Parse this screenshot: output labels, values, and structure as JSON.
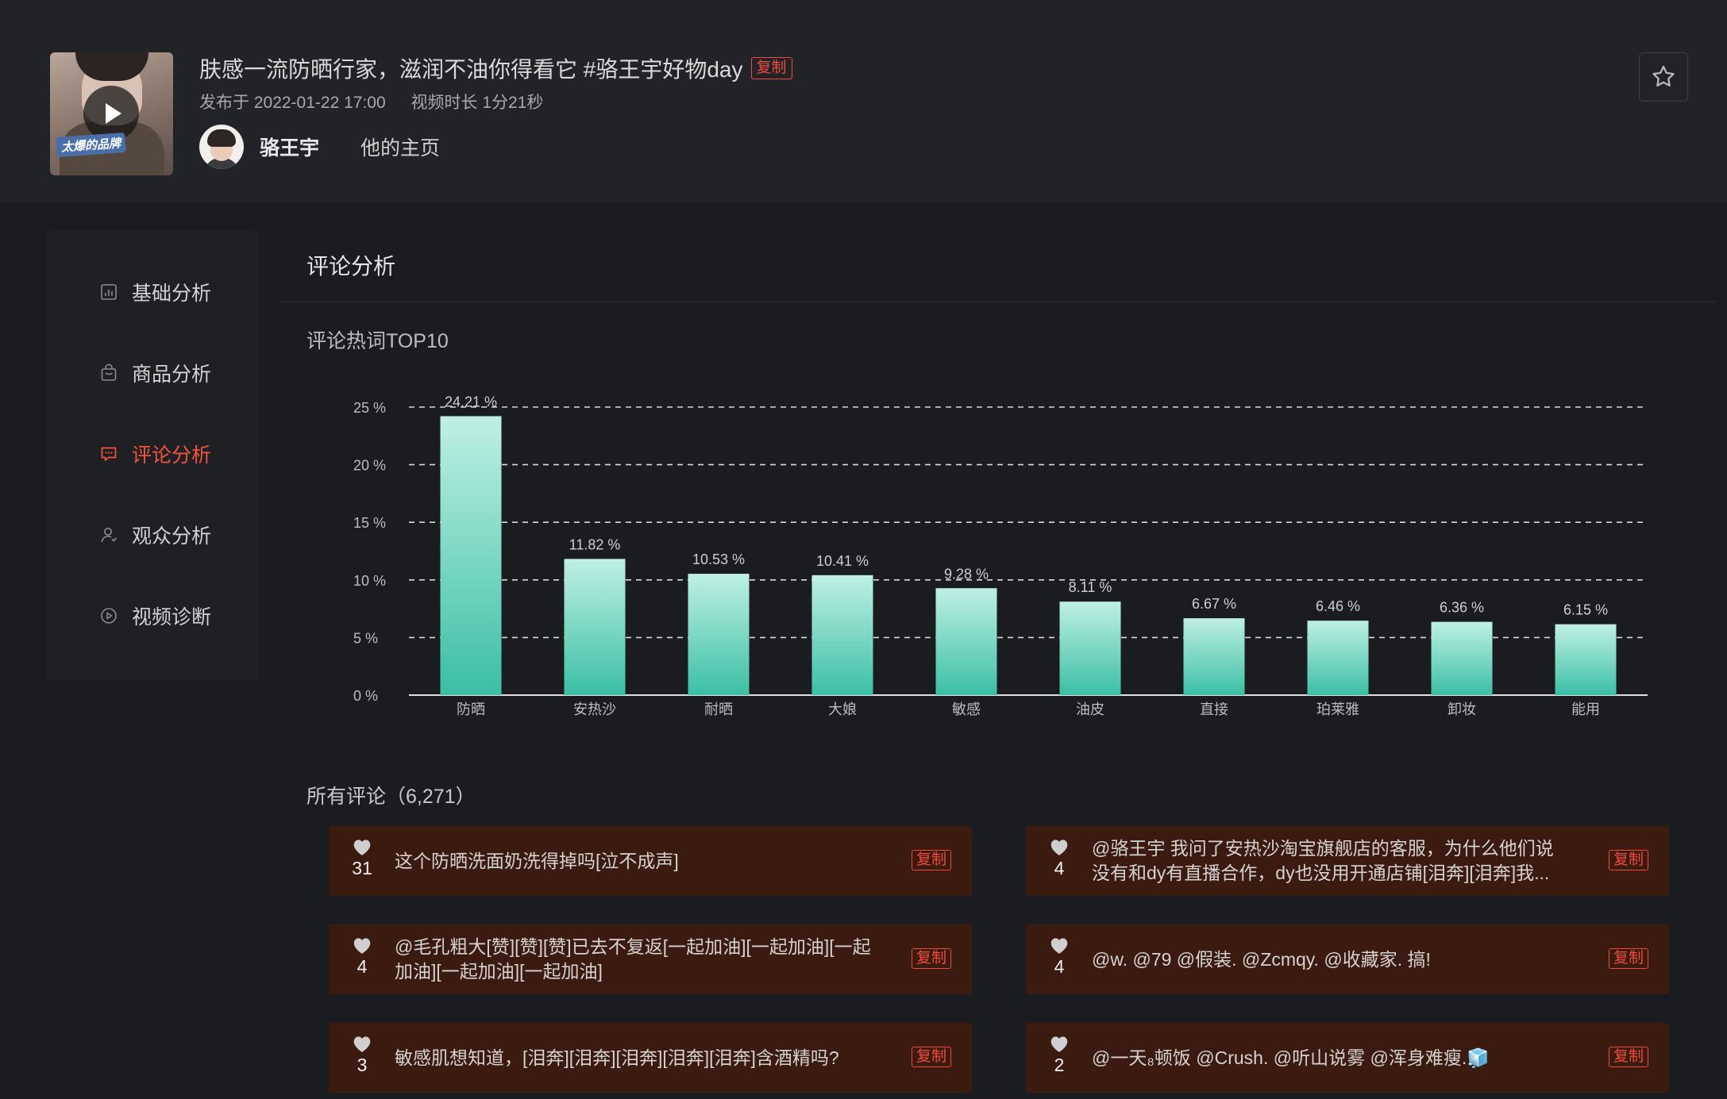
{
  "header": {
    "title": "肤感一流防晒行家，滋润不油你得看它 #骆王宇好物day",
    "copy_label": "复制",
    "publish_time": "发布于 2022-01-22 17:00",
    "duration": "视频时长 1分21秒",
    "author_name": "骆王宇",
    "homepage_label": "他的主页",
    "thumbnail_sticker": "太爆的品牌"
  },
  "sidebar": {
    "items": [
      {
        "label": "基础分析",
        "icon": "bar-chart-icon",
        "active": false
      },
      {
        "label": "商品分析",
        "icon": "shopping-bag-icon",
        "active": false
      },
      {
        "label": "评论分析",
        "icon": "comment-icon",
        "active": true
      },
      {
        "label": "观众分析",
        "icon": "user-icon",
        "active": false
      },
      {
        "label": "视频诊断",
        "icon": "play-circle-icon",
        "active": false
      }
    ]
  },
  "main": {
    "section_title": "评论分析",
    "chart_title": "评论热词TOP10",
    "comments_title": "所有评论（6,271）"
  },
  "chart_data": {
    "type": "bar",
    "categories": [
      "防晒",
      "安热沙",
      "耐晒",
      "大娘",
      "敏感",
      "油皮",
      "直接",
      "珀莱雅",
      "卸妆",
      "能用"
    ],
    "values": [
      24.21,
      11.82,
      10.53,
      10.41,
      9.28,
      8.11,
      6.67,
      6.46,
      6.36,
      6.15
    ],
    "value_labels": [
      "24.21 %",
      "11.82 %",
      "10.53 %",
      "10.41 %",
      "9.28 %",
      "8.11 %",
      "6.67 %",
      "6.46 %",
      "6.36 %",
      "6.15 %"
    ],
    "yticks": [
      "0 %",
      "5 %",
      "10 %",
      "15 %",
      "20 %",
      "25 %"
    ],
    "ylim": [
      0,
      25
    ],
    "grid": true,
    "colors": {
      "bar_top": "#bff0e4",
      "bar_bottom": "#3bbfa5"
    }
  },
  "comments": [
    {
      "likes": "31",
      "text": "这个防晒洗面奶洗得掉吗[泣不成声]",
      "copy": "复制"
    },
    {
      "likes": "4",
      "text": "@骆王宇 我问了安热沙淘宝旗舰店的客服，为什么他们说没有和dy有直播合作，dy也没用开通店铺[泪奔][泪奔]我...",
      "copy": "复制"
    },
    {
      "likes": "4",
      "text": "@毛孔粗大[赞][赞][赞]已去不复返[一起加油][一起加油][一起加油][一起加油][一起加油]",
      "copy": "复制"
    },
    {
      "likes": "4",
      "text": "@w. @79 @假装. @Zcmqy. @收藏家. 搞!",
      "copy": "复制"
    },
    {
      "likes": "3",
      "text": "敏感肌想知道，[泪奔][泪奔][泪奔][泪奔][泪奔]含酒精吗?",
      "copy": "复制"
    },
    {
      "likes": "2",
      "text": "@一天₈顿饭 @Crush. @听山说雾 @浑身难瘦.🧊",
      "copy": "复制"
    }
  ],
  "colors": {
    "accent": "#f0543d",
    "background": "#1b1c20",
    "card": "#3b1a10"
  }
}
